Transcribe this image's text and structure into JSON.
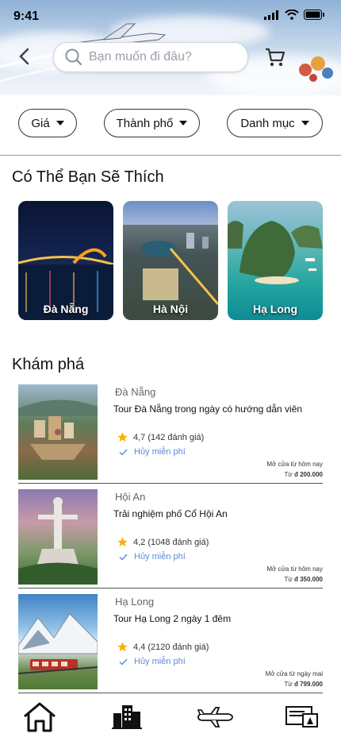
{
  "status": {
    "time": "9:41"
  },
  "search": {
    "placeholder": "Bạn muốn đi đâu?"
  },
  "filters": [
    {
      "label": "Giá"
    },
    {
      "label": "Thành phố"
    },
    {
      "label": "Danh mục"
    }
  ],
  "suggest": {
    "title": "Có Thể Bạn Sẽ Thích",
    "cities": [
      {
        "name": "Đà Nẵng"
      },
      {
        "name": "Hà Nội"
      },
      {
        "name": "Hạ Long"
      }
    ]
  },
  "explore": {
    "title": "Khám phá",
    "items": [
      {
        "location": "Đà Nẵng",
        "title": "Tour Đà Nẵng trong ngày có hướng dẫn viên",
        "rating": "4,7 (142 đánh giá)",
        "cancel": "Hủy miễn phí",
        "open": "Mở cửa từ hôm nay",
        "price_prefix": "Từ",
        "price": "đ 200.000"
      },
      {
        "location": "Hội An",
        "title": "Trải nghiệm phố Cổ Hội An",
        "rating": "4,2 (1048 đánh giá)",
        "cancel": "Hủy miễn phí",
        "open": "Mở cửa từ hôm nay",
        "price_prefix": "Từ",
        "price": "đ 350.000"
      },
      {
        "location": "Hạ Long",
        "title": "Tour Hạ Long 2 ngày 1 đêm",
        "rating": "4,4 (2120 đánh giá)",
        "cancel": "Hủy miễn phí",
        "open": "Mở cửa từ ngày mai",
        "price_prefix": "Từ",
        "price": "đ 799.000"
      }
    ]
  },
  "icons": [
    "back-arrow-icon",
    "search-icon",
    "cart-icon",
    "home-icon",
    "hotel-icon",
    "airplane-icon",
    "ticket-icon"
  ],
  "colors": {
    "accent_blue": "#5b88d6",
    "star": "#f5b301"
  }
}
